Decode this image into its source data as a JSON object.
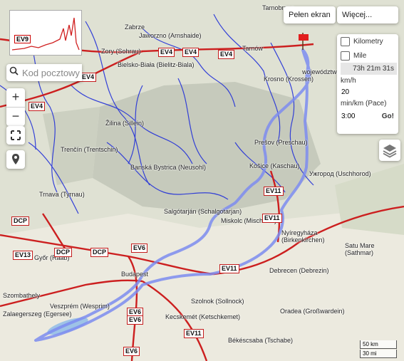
{
  "buttons": {
    "fullscreen": "Pełen ekran",
    "more": "Więcej..."
  },
  "search": {
    "placeholder": "Kod pocztowy"
  },
  "panel": {
    "km_label": "Kilometry",
    "mile_label": "Mile",
    "duration": "73h 21m 31s",
    "speed_label": "km/h",
    "speed_value": "20",
    "pace_label": "min/km (Pace)",
    "pace_value": "3:00",
    "go_label": "Go!"
  },
  "scale": {
    "km": "50 km",
    "mi": "30 mi"
  },
  "elevation_profile": {
    "label": "EV9"
  },
  "map_labels": [
    "Tarnobrzeg",
    "Zabrze",
    "Jaworzno (Arnshaide)",
    "Zory (Sohrau)",
    "Bielsko-Biała (Bielitz-Biala)",
    "Tarnów",
    "województwo małopolskie",
    "Krosno (Krossen)",
    "Žilina (Sillein)",
    "Trenčín (Trentschin)",
    "Banská Bystrica (Neusohl)",
    "Prešov (Preschau)",
    "Košice (Kaschau)",
    "Ужгород (Uschhorod)",
    "Trnava (Tyrnau)",
    "Salgótarján (Schalgotarjan)",
    "Miskolc (Mischkolz)",
    "Nyíregyháza (Birkenkirchen)",
    "Satu Mare (Sathmar)",
    "Győr (Raab)",
    "Budapest",
    "Debrecen (Debrezin)",
    "Szolnok (Sollnock)",
    "Veszprém (Wesprim)",
    "Kecskemét (Ketschkemet)",
    "Oradea (Großwardein)",
    "Békéscsaba (Tschabe)",
    "Zalaegerszeg (Egersee)",
    "Szombathely"
  ],
  "road_labels": [
    "EV9",
    "EV4",
    "EV11",
    "EV6",
    "DCP",
    "EV13"
  ],
  "colors": {
    "route": "#7c8cf0",
    "rivers": "#2230d8",
    "roads": "#cc1f1f",
    "terrain": "#c6cbbf"
  },
  "icons": {
    "search": "search-icon",
    "fullscreen": "expand-icon",
    "pin": "location-pin-icon",
    "layers": "layers-icon",
    "flag": "flag-icon"
  }
}
